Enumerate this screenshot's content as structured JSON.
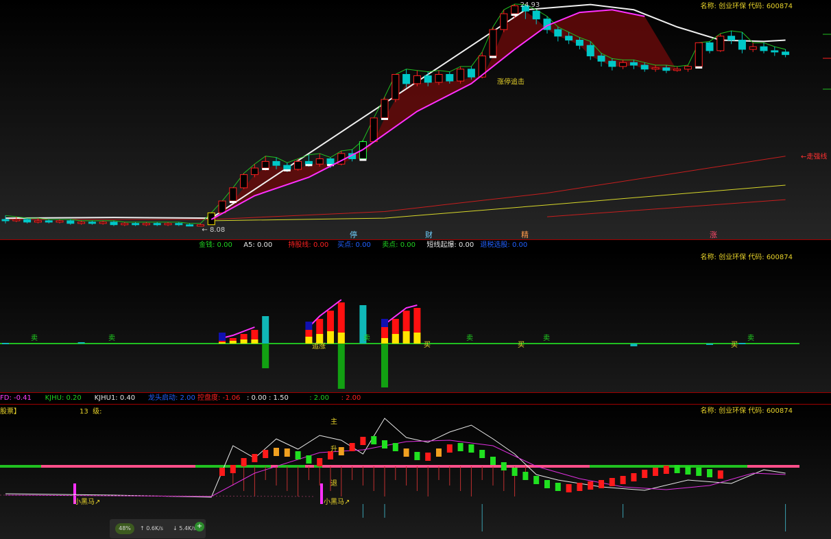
{
  "panel1": {
    "title": "名称: 创业环保 代码: 600874",
    "price_high": "24.93",
    "price_low": "8.08",
    "zhangting_label": "涨停追击",
    "trend_label": "←走强线",
    "markers": [
      {
        "t": "停",
        "c": "#6fd0ff"
      },
      {
        "t": "财",
        "c": "#6fd0ff"
      },
      {
        "t": "精",
        "c": "#ff9a4a"
      },
      {
        "t": "涨",
        "c": "#ff4a6a"
      }
    ]
  },
  "status1": [
    {
      "t": "金钱: 0.00",
      "c": "#20d020"
    },
    {
      "t": "A5: 0.00",
      "c": "#e8e8e8"
    },
    {
      "t": "持股线: 0.00",
      "c": "#ff2020"
    },
    {
      "t": "买点: 0.00",
      "c": "#2060ff"
    },
    {
      "t": "卖点: 0.00",
      "c": "#20d020"
    },
    {
      "t": "短线起爆: 0.00",
      "c": "#e8e8e8"
    },
    {
      "t": "退税选股: 0.00",
      "c": "#2060ff"
    }
  ],
  "panel2": {
    "title": "名称: 创业环保 代码: 600874",
    "labels": {
      "sell": "卖",
      "buy": "买",
      "zhui": "追涨"
    }
  },
  "status2": [
    {
      "t": "FD: -0.41",
      "c": "#ff40ff"
    },
    {
      "t": "KJHU: 0.20",
      "c": "#20d020"
    },
    {
      "t": "KJHU1: 0.40",
      "c": "#e8e8e8"
    },
    {
      "t": "龙头启动: 2.00",
      "c": "#2060ff"
    },
    {
      "t": "控盘度: -1.06",
      "c": "#ff2020"
    },
    {
      "t": ": 0.00 : 1.50",
      "c": "#e8e8e8"
    },
    {
      "t": ": 2.00",
      "c": "#20d020"
    },
    {
      "t": ": 2.00",
      "c": "#ff2020"
    }
  ],
  "panel3": {
    "title": "名称: 创业环保 代码: 600874",
    "header_left": "股票】",
    "header_mid": "13  级:",
    "labels": {
      "zhu": "主",
      "sheng": "升",
      "tui": "退",
      "xiaohei": "小黑马↗"
    }
  },
  "widget": {
    "percent": "48%",
    "up_speed": "0.6K/s",
    "down_speed": "5.4K/s",
    "plus": "+"
  },
  "colors": {
    "up": "#ff2020",
    "down": "#00c8c8",
    "ma": "#ff30ff",
    "white_line": "#f0f0f0",
    "yellow_line": "#d8d82a",
    "red_line": "#c81e1e",
    "green_line": "#20c020"
  },
  "chart_data": [
    {
      "type": "candlestick",
      "name_display": "名称: 创业环保 代码: 600874",
      "price_max": 24.93,
      "price_min": 8.08,
      "candles": [
        [
          8.6,
          8.5,
          8.9,
          8.3
        ],
        [
          8.5,
          8.6,
          8.8,
          8.4
        ],
        [
          8.6,
          8.4,
          8.7,
          8.3
        ],
        [
          8.4,
          8.5,
          8.7,
          8.3
        ],
        [
          8.5,
          8.4,
          8.6,
          8.3
        ],
        [
          8.4,
          8.5,
          8.6,
          8.3
        ],
        [
          8.5,
          8.3,
          8.6,
          8.2
        ],
        [
          8.3,
          8.4,
          8.5,
          8.2
        ],
        [
          8.4,
          8.3,
          8.5,
          8.2
        ],
        [
          8.3,
          8.4,
          8.5,
          8.2
        ],
        [
          8.4,
          8.2,
          8.5,
          8.1
        ],
        [
          8.2,
          8.3,
          8.4,
          8.1
        ],
        [
          8.3,
          8.2,
          8.4,
          8.1
        ],
        [
          8.2,
          8.3,
          8.4,
          8.1
        ],
        [
          8.3,
          8.2,
          8.4,
          8.1
        ],
        [
          8.2,
          8.3,
          8.4,
          8.1
        ],
        [
          8.3,
          8.2,
          8.4,
          8.1
        ],
        [
          8.2,
          8.1,
          8.3,
          8.08
        ],
        [
          8.1,
          8.2,
          8.3,
          8.08
        ],
        [
          8.2,
          9.1,
          9.1,
          8.2
        ],
        [
          9.1,
          10.0,
          10.0,
          9.1
        ],
        [
          10.0,
          11.0,
          11.0,
          10.0
        ],
        [
          11.0,
          12.0,
          12.1,
          10.9
        ],
        [
          12.0,
          12.5,
          12.8,
          11.8
        ],
        [
          12.5,
          13.0,
          13.4,
          12.3
        ],
        [
          13.0,
          12.7,
          13.3,
          12.4
        ],
        [
          12.7,
          12.4,
          12.9,
          12.2
        ],
        [
          12.4,
          13.0,
          13.2,
          12.3
        ],
        [
          13.0,
          12.8,
          13.5,
          12.6
        ],
        [
          12.8,
          13.2,
          13.6,
          12.6
        ],
        [
          13.2,
          12.8,
          13.3,
          12.5
        ],
        [
          12.8,
          13.6,
          13.8,
          12.7
        ],
        [
          13.6,
          13.2,
          13.9,
          13.0
        ],
        [
          13.2,
          14.5,
          14.6,
          13.1
        ],
        [
          14.5,
          16.3,
          16.3,
          14.4
        ],
        [
          16.3,
          17.7,
          17.9,
          16.2
        ],
        [
          17.7,
          19.6,
          19.6,
          17.5
        ],
        [
          19.6,
          18.9,
          20.0,
          18.6
        ],
        [
          18.9,
          19.5,
          19.9,
          18.7
        ],
        [
          19.5,
          19.0,
          19.8,
          18.7
        ],
        [
          19.0,
          19.6,
          19.9,
          18.8
        ],
        [
          19.6,
          19.1,
          19.8,
          18.9
        ],
        [
          19.1,
          20.0,
          20.2,
          18.9
        ],
        [
          20.0,
          19.4,
          20.2,
          19.2
        ],
        [
          19.4,
          21.0,
          21.3,
          19.3
        ],
        [
          21.0,
          23.0,
          23.2,
          20.9
        ],
        [
          23.0,
          24.2,
          24.5,
          22.8
        ],
        [
          24.2,
          24.8,
          24.93,
          23.9
        ],
        [
          24.8,
          24.4,
          24.9,
          23.8
        ],
        [
          24.4,
          23.8,
          24.5,
          23.4
        ],
        [
          23.8,
          23.0,
          24.0,
          22.7
        ],
        [
          23.0,
          22.5,
          23.2,
          22.1
        ],
        [
          22.5,
          22.2,
          22.8,
          21.9
        ],
        [
          22.2,
          21.8,
          22.4,
          21.5
        ],
        [
          21.8,
          21.0,
          22.1,
          20.7
        ],
        [
          21.0,
          20.6,
          21.2,
          20.2
        ],
        [
          20.6,
          20.2,
          20.8,
          19.9
        ],
        [
          20.2,
          20.5,
          20.7,
          20.0
        ],
        [
          20.5,
          20.3,
          20.7,
          20.0
        ],
        [
          20.3,
          20.0,
          20.5,
          19.8
        ],
        [
          20.0,
          20.1,
          20.3,
          19.8
        ],
        [
          20.1,
          19.9,
          20.3,
          19.7
        ],
        [
          19.9,
          20.0,
          20.2,
          19.8
        ],
        [
          20.0,
          20.2,
          20.3,
          19.8
        ],
        [
          20.2,
          22.0,
          22.0,
          20.1
        ],
        [
          22.0,
          21.4,
          22.1,
          21.2
        ],
        [
          21.4,
          22.5,
          22.7,
          21.3
        ],
        [
          22.5,
          22.2,
          22.9,
          21.9
        ],
        [
          22.2,
          21.5,
          22.8,
          21.2
        ],
        [
          21.5,
          21.7,
          22.0,
          21.3
        ],
        [
          21.7,
          21.4,
          22.0,
          21.2
        ],
        [
          21.4,
          21.3,
          21.7,
          21.0
        ],
        [
          21.3,
          21.1,
          21.5,
          20.9
        ]
      ],
      "highlights": {
        "yellow": [
          19
        ],
        "green": [
          33
        ],
        "white_marks": [
          21,
          24,
          26,
          28,
          30,
          33,
          35,
          45,
          47,
          64
        ]
      },
      "lines": {
        "ma_magenta": [
          [
            19,
            8.6
          ],
          [
            23,
            10.4
          ],
          [
            28,
            11.8
          ],
          [
            33,
            13.9
          ],
          [
            38,
            16.8
          ],
          [
            43,
            18.9
          ],
          [
            47,
            21.5
          ],
          [
            50,
            23.3
          ],
          [
            53,
            24.3
          ],
          [
            56,
            24.5
          ],
          [
            59,
            24.0
          ]
        ],
        "white_ma": [
          [
            0,
            8.7
          ],
          [
            10,
            8.75
          ],
          [
            19,
            8.7
          ],
          [
            48,
            24.5
          ],
          [
            54,
            24.9
          ],
          [
            58,
            24.5
          ],
          [
            62,
            23.2
          ],
          [
            66,
            22.2
          ],
          [
            70,
            22.1
          ],
          [
            72,
            22.2
          ]
        ],
        "trend_red": [
          [
            0,
            8.6
          ],
          [
            19,
            8.6
          ],
          [
            35,
            9.2
          ],
          [
            50,
            10.6
          ],
          [
            72,
            13.4
          ]
        ],
        "trend_yellow": [
          [
            19,
            8.5
          ],
          [
            35,
            8.7
          ],
          [
            50,
            9.7
          ],
          [
            72,
            11.2
          ]
        ],
        "trend_red2": [
          [
            50,
            8.8
          ],
          [
            72,
            10.1
          ]
        ]
      },
      "labels_text": [
        "24.93",
        "8.08",
        "涨停追击",
        "←走强线",
        "停",
        "财",
        "精",
        "涨"
      ]
    },
    {
      "type": "bar",
      "name_display": "名称: 创业环保 代码: 600874",
      "positive_groups": [
        {
          "x": [
            20,
            21,
            22,
            23
          ],
          "red": [
            2,
            4,
            7,
            10
          ],
          "yellow": [
            1,
            2,
            3,
            3
          ]
        },
        {
          "x": [
            28,
            29,
            30,
            31
          ],
          "red": [
            10,
            18,
            24,
            30
          ],
          "yellow": [
            5,
            7,
            9,
            8
          ]
        },
        {
          "x": [
            35,
            36,
            37,
            38
          ],
          "red": [
            12,
            18,
            24,
            26
          ],
          "yellow": [
            4,
            7,
            9,
            8
          ]
        }
      ],
      "cyan": [
        [
          0,
          0.5
        ],
        [
          7,
          1
        ],
        [
          24,
          20
        ],
        [
          33,
          28
        ],
        [
          58,
          -2
        ],
        [
          65,
          -1
        ],
        [
          68,
          0.5
        ]
      ],
      "negative_green": [
        [
          24,
          -18
        ],
        [
          31,
          -33
        ],
        [
          35,
          -32
        ]
      ]
    },
    {
      "type": "line",
      "name_display": "名称: 创业环保 代码: 600874",
      "white": [
        [
          0,
          60
        ],
        [
          10,
          58
        ],
        [
          19,
          55
        ],
        [
          21,
          130
        ],
        [
          23,
          112
        ],
        [
          25,
          140
        ],
        [
          27,
          125
        ],
        [
          29,
          145
        ],
        [
          31,
          138
        ],
        [
          33,
          118
        ],
        [
          35,
          170
        ],
        [
          37,
          142
        ],
        [
          39,
          135
        ],
        [
          41,
          150
        ],
        [
          43,
          160
        ],
        [
          45,
          140
        ],
        [
          47,
          118
        ],
        [
          49,
          88
        ],
        [
          51,
          80
        ],
        [
          55,
          70
        ],
        [
          59,
          65
        ],
        [
          63,
          80
        ],
        [
          67,
          75
        ],
        [
          70,
          95
        ],
        [
          72,
          90
        ]
      ],
      "magenta_avg": [
        [
          0,
          58
        ],
        [
          19,
          56
        ],
        [
          23,
          90
        ],
        [
          29,
          120
        ],
        [
          33,
          124
        ],
        [
          37,
          136
        ],
        [
          41,
          138
        ],
        [
          45,
          130
        ],
        [
          49,
          100
        ],
        [
          53,
          82
        ],
        [
          57,
          70
        ],
        [
          61,
          66
        ],
        [
          65,
          72
        ],
        [
          69,
          90
        ],
        [
          72,
          88
        ]
      ],
      "step_blocks": [
        [
          20,
          92
        ],
        [
          21,
          96
        ],
        [
          22,
          106
        ],
        [
          23,
          112
        ],
        [
          24,
          118
        ],
        [
          25,
          121
        ],
        [
          26,
          120
        ],
        [
          27,
          116
        ],
        [
          28,
          110
        ],
        [
          29,
          106
        ],
        [
          30,
          116
        ],
        [
          31,
          122
        ],
        [
          32,
          128
        ],
        [
          33,
          137
        ],
        [
          34,
          138
        ],
        [
          35,
          132
        ],
        [
          36,
          128
        ],
        [
          37,
          120
        ],
        [
          38,
          115
        ],
        [
          39,
          114
        ],
        [
          40,
          120
        ],
        [
          41,
          126
        ],
        [
          42,
          128
        ],
        [
          43,
          126
        ],
        [
          44,
          118
        ],
        [
          45,
          108
        ],
        [
          46,
          100
        ],
        [
          47,
          92
        ],
        [
          48,
          86
        ],
        [
          49,
          80
        ],
        [
          50,
          74
        ],
        [
          51,
          70
        ],
        [
          52,
          68
        ],
        [
          53,
          70
        ],
        [
          54,
          72
        ],
        [
          55,
          74
        ],
        [
          56,
          77
        ],
        [
          57,
          80
        ],
        [
          58,
          84
        ],
        [
          59,
          89
        ],
        [
          60,
          92
        ],
        [
          61,
          95
        ],
        [
          62,
          96
        ],
        [
          63,
          94
        ],
        [
          64,
          92
        ],
        [
          65,
          90
        ],
        [
          66,
          88
        ]
      ],
      "level": 100
    }
  ]
}
